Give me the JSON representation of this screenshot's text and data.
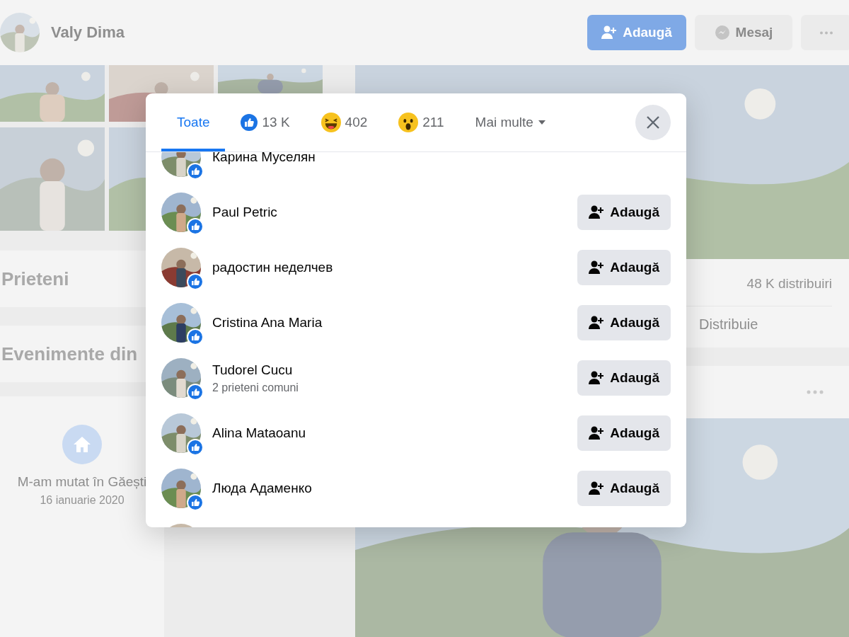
{
  "profile": {
    "name": "Valy Dima",
    "buttons": [
      {
        "kind": "add",
        "label": "Adaugă"
      },
      {
        "kind": "message",
        "label": "Mesaj"
      },
      {
        "kind": "more"
      }
    ]
  },
  "left": {
    "sections": [
      "Prieteni",
      "Evenimente din"
    ],
    "life_event": {
      "title": "M-am mutat în Găești",
      "date": "16 ianuarie 2020"
    }
  },
  "post": {
    "shares": "48 K distribuiri",
    "share_action": "Distribuie"
  },
  "reactions_dialog": {
    "tabs": [
      {
        "kind": "all",
        "label": "Toate",
        "selected": true
      },
      {
        "kind": "like",
        "label": "13 K",
        "selected": false
      },
      {
        "kind": "haha",
        "label": "402",
        "selected": false
      },
      {
        "kind": "wow",
        "label": "211",
        "selected": false
      },
      {
        "kind": "more",
        "label": "Mai multe",
        "selected": false
      }
    ],
    "people": [
      {
        "name": "Карина Муселян"
      },
      {
        "name": "Paul Petric",
        "button": "Adaugă"
      },
      {
        "name": "радостин неделчев",
        "button": "Adaugă"
      },
      {
        "name": "Cristina Ana Maria",
        "button": "Adaugă"
      },
      {
        "name": "Tudorel Cucu",
        "subtitle": "2 prieteni comuni",
        "button": "Adaugă"
      },
      {
        "name": "Alina Mataoanu",
        "button": "Adaugă"
      },
      {
        "name": "Люда Адаменко",
        "button": "Adaugă"
      }
    ]
  }
}
